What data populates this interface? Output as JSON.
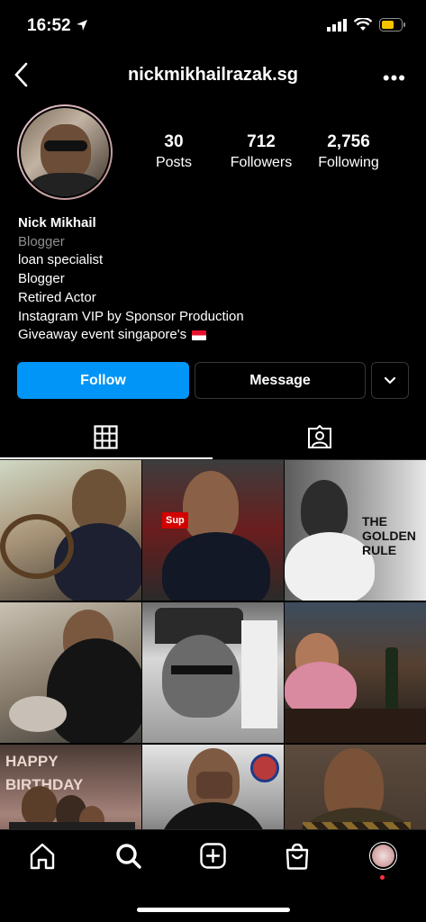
{
  "status": {
    "time": "16:52"
  },
  "header": {
    "username": "nickmikhailrazak.sg",
    "more_label": "•••"
  },
  "stats": [
    {
      "value": "30",
      "label": "Posts"
    },
    {
      "value": "712",
      "label": "Followers"
    },
    {
      "value": "2,756",
      "label": "Following"
    }
  ],
  "bio": {
    "name": "Nick Mikhail",
    "category": "Blogger",
    "lines": [
      "loan specialist",
      "Blogger",
      "Retired Actor",
      "Instagram VIP by Sponsor Production",
      "Giveaway event singapore's"
    ]
  },
  "actions": {
    "follow": "Follow",
    "message": "Message"
  },
  "grid_posts": [
    {
      "caption": ""
    },
    {
      "caption": "Sup"
    },
    {
      "caption": "THE GOLDEN RULE"
    },
    {
      "caption": ""
    },
    {
      "caption": ""
    },
    {
      "caption": ""
    },
    {
      "caption": "HAPPY BIRTHDAY"
    },
    {
      "caption": ""
    },
    {
      "caption": ""
    }
  ],
  "colors": {
    "accent": "#0095f6",
    "background": "#000000",
    "muted": "#8e8e8e",
    "border": "#363636"
  },
  "icons": {
    "tab_grid": "grid-icon",
    "tab_tagged": "tagged-icon",
    "nav": [
      "home-icon",
      "search-icon",
      "create-icon",
      "shop-icon",
      "profile-avatar"
    ]
  }
}
